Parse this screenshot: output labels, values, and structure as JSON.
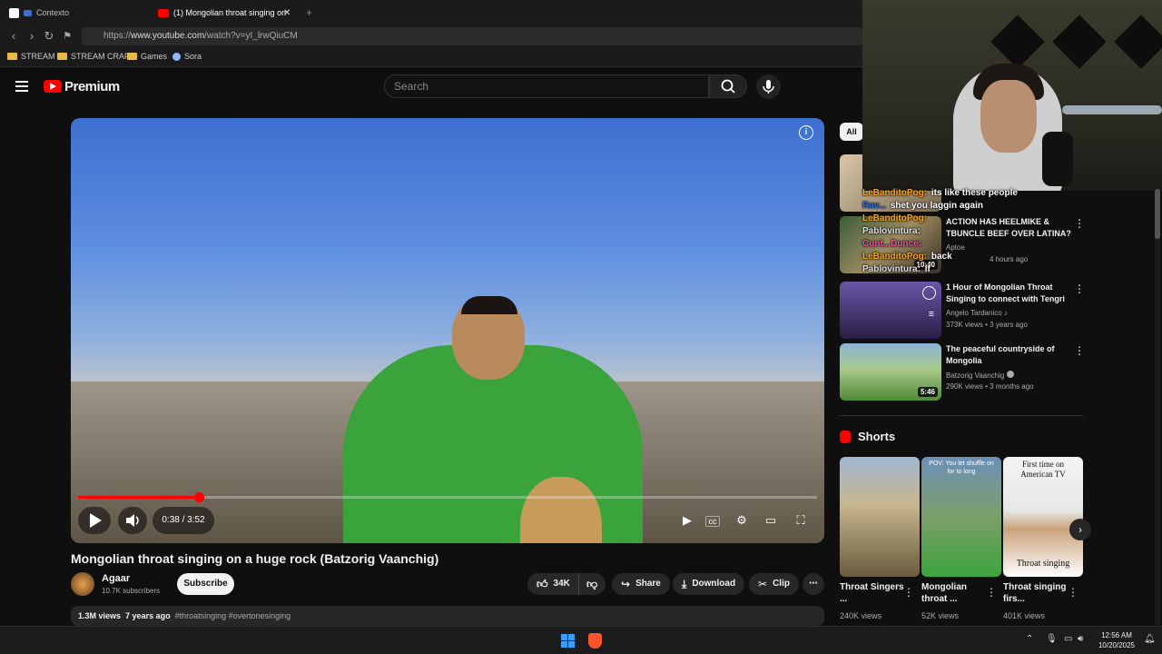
{
  "browser": {
    "tabs": [
      {
        "label": "Contexto",
        "favicon_color": "#ffffff",
        "active": false
      },
      {
        "label": "(1) Mongolian throat singing on",
        "favicon_color": "#ff0000",
        "active": true
      }
    ],
    "new_tab_glyph": "+",
    "close_glyph": "✕",
    "url_prefix": "https://",
    "url_host": "www.youtube.com",
    "url_path": "/watch?v=yI_lrwQiuCM",
    "bookmarks": [
      "STREAM",
      "STREAM CRAP",
      "Games",
      "Sora"
    ]
  },
  "header": {
    "brand": "Premium",
    "search_placeholder": "Search"
  },
  "player": {
    "time_label": "0:38 / 3:52",
    "progress_fraction": 0.163,
    "accent": "#ff0000"
  },
  "video": {
    "title": "Mongolian throat singing on a huge rock (Batzorig Vaanchig)",
    "channel": "Agaar",
    "subscribers": "10.7K subscribers",
    "subscribe_label": "Subscribe",
    "likes": "34K",
    "share_label": "Share",
    "download_label": "Download",
    "clip_label": "Clip",
    "views": "1.3M views",
    "age": "7 years ago",
    "hashtags": "#throatsinging #overtonesinging"
  },
  "sidebar": {
    "chip_all": "All",
    "recommendations": [
      {
        "title": "",
        "channel": "",
        "meta": "",
        "duration": ""
      },
      {
        "title": "ACTION HAS HEELMIKE & TBUNCLE BEEF OVER LATINA?",
        "channel": "Aptoe",
        "meta": "4 hours ago",
        "duration": "10:40"
      },
      {
        "title": "1 Hour of Mongolian Throat Singing to connect with Tengri",
        "channel": "Angelo Tardanico ♪",
        "meta": "373K views • 3 years ago",
        "duration": ""
      },
      {
        "title": "The peaceful countryside of Mongolia",
        "channel": "Batzorig Vaanchig",
        "meta": "290K views • 3 months ago",
        "duration": "5:46"
      }
    ],
    "shorts_heading": "Shorts",
    "shorts": [
      {
        "title": "Throat Singers ...",
        "views": "240K views",
        "overlay": ""
      },
      {
        "title": "Mongolian throat ...",
        "views": "52K views",
        "overlay": "POV: You let shuffle on for to long"
      },
      {
        "title": "Throat singing firs...",
        "views": "401K views",
        "overlay": "First time on American TV",
        "caption": "Throat singing"
      }
    ]
  },
  "chat": [
    {
      "user": "LeBanditoPog:",
      "message": "its like these people",
      "color": "#f5a623"
    },
    {
      "user": "Rav...",
      "message": "shet you laggin again",
      "color": "#2f6fd8"
    },
    {
      "user": "LeBanditoPog:",
      "message": "",
      "color": "#f5a623"
    },
    {
      "user": "Pablovintura:",
      "message": "",
      "color": "#e0e0e0"
    },
    {
      "user": "Cunt...Dunce:",
      "message": "",
      "color": "#e05a9c"
    },
    {
      "user": "LeBanditoPog:",
      "message": "back",
      "color": "#f5a623"
    },
    {
      "user": "Pablovintura:",
      "message": "lf",
      "color": "#e0e0e0"
    }
  ],
  "taskbar": {
    "time": "12:56 AM",
    "date": "10/20/2025"
  }
}
